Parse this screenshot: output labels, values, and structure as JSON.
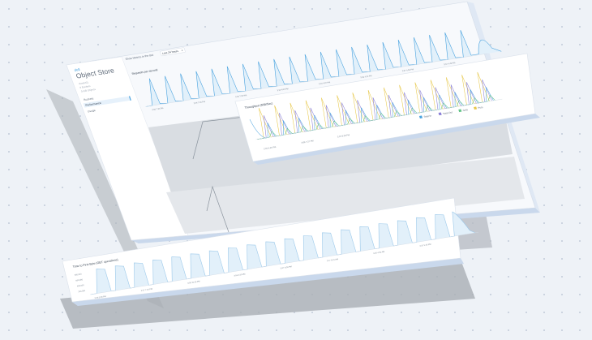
{
  "app": {
    "title": "Object Store",
    "logo": "dell",
    "subtitles": [
      "cluster01",
      "0 Buckets",
      "0 KiB Objects"
    ]
  },
  "sidebar": {
    "items": [
      {
        "label": "Buckets",
        "active": false
      },
      {
        "label": "Performance",
        "active": true
      },
      {
        "label": "Usage",
        "active": false
      }
    ]
  },
  "toolbar": {
    "metrics_label": "Show Metrics in the last",
    "range_value": "Last 24 hours"
  },
  "charts": {
    "requests": {
      "title": "Requests per second",
      "ticks": [
        "2:50 PM",
        "3:00 PM",
        "3:10 PM",
        "3:20 PM",
        "3:30 PM",
        "3:40 PM",
        "3:50 PM",
        "4:00 PM"
      ],
      "tick_labels": [
        "2:56 7:25 PM",
        "2:59 7:29 PM",
        "3:03 7:35 PM",
        "3:10 4:00 PM",
        "3:13 4:07 PM",
        "3:22 4:21 PM",
        "3:37 4:30 PM",
        "3:57 4:48 PM"
      ]
    },
    "throughput": {
      "title": "Throughput (MiB/Sec)",
      "tick_labels": [
        "2:56 4:45 PM",
        "3:06 7:27 PM",
        "3:16 8:30 PM"
      ],
      "legend": [
        {
          "label": "Total In",
          "color": "#4aa3df"
        },
        {
          "label": "Total Out",
          "color": "#8a7fd6"
        },
        {
          "label": "Gets",
          "color": "#63c487"
        },
        {
          "label": "Puts",
          "color": "#e7c84b"
        }
      ]
    },
    "ttfb": {
      "title": "Time to First Byte (GET operations)",
      "y_ticks": [
        "800,000",
        "600,000",
        "400,000",
        "200,000"
      ],
      "tick_labels": [
        "2:56 3:06 PM",
        "2:57 7:25 PM",
        "3:00 10:30 PM",
        "3:04 4:30 PM",
        "3:07 8:30 PM",
        "3:17 6:21 AM",
        "3:20 4:30 AM",
        "3:37 5:45 PM"
      ]
    }
  },
  "colors": {
    "accent": "#4aa3df",
    "line_light": "#9cc9ea",
    "panel_side": "#d7e3f2",
    "shadow": "#a9aeb4"
  }
}
